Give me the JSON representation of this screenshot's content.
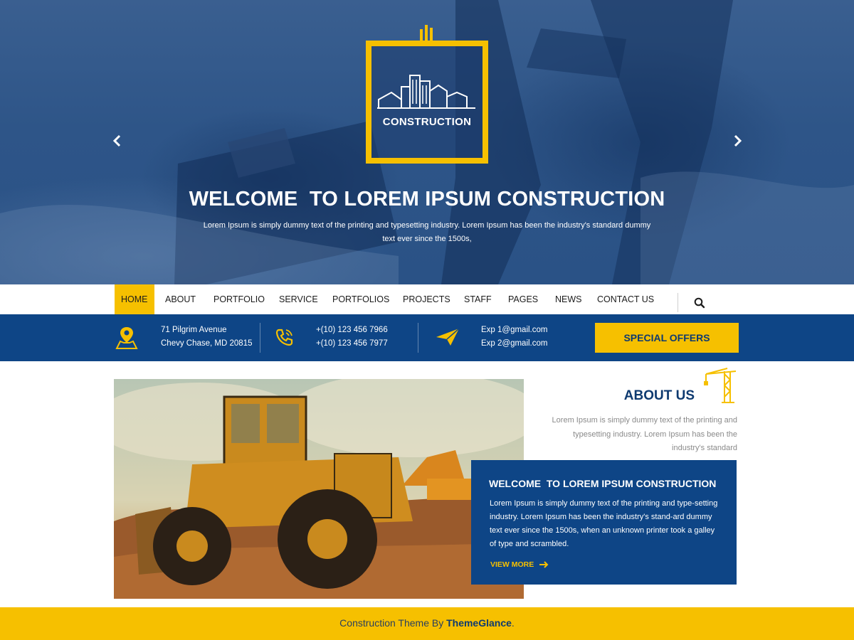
{
  "hero": {
    "logo_text": "CONSTRUCTION",
    "title": "WELCOME  TO LOREM IPSUM CONSTRUCTION",
    "subtitle": "Lorem Ipsum is simply dummy text of the printing and typesetting industry. Lorem Ipsum has been the industry's standard dummy text ever since the 1500s,",
    "prev_icon": "chevron-left-icon",
    "next_icon": "chevron-right-icon"
  },
  "nav": {
    "items": [
      "HOME",
      "ABOUT",
      "PORTFOLIO",
      "SERVICE",
      "PORTFOLIOS",
      "PROJECTS",
      "STAFF",
      "PAGES",
      "NEWS",
      "CONTACT US"
    ],
    "active": "HOME",
    "search_icon": "search-icon"
  },
  "infobar": {
    "address_line1": "71 Pilgrim Avenue",
    "address_line2": "Chevy Chase, MD 20815",
    "phone1": "+(10) 123 456 7966",
    "phone2": "+(10) 123 456 7977",
    "email1": "Exp 1@gmail.com",
    "email2": "Exp 2@gmail.com",
    "offers_label": "SPECIAL OFFERS"
  },
  "about": {
    "title": "ABOUT US",
    "text": "Lorem Ipsum is simply dummy text of the printing and typesetting industry. Lorem Ipsum has been the industry's standard"
  },
  "card": {
    "title": "WELCOME  TO LOREM IPSUM CONSTRUCTION",
    "text": "Lorem Ipsum is simply dummy text of the printing and type-setting industry. Lorem Ipsum has been the industry's stand-ard dummy text ever since the 1500s, when an unknown printer took a galley of type and scrambled.",
    "link_label": "VIEW MORE"
  },
  "footer": {
    "prefix": "Construction Theme By ",
    "brand": "ThemeGlance",
    "suffix": "."
  },
  "colors": {
    "accent_yellow": "#f6c000",
    "brand_blue": "#0e4586",
    "dark_blue": "#0e3a70"
  }
}
